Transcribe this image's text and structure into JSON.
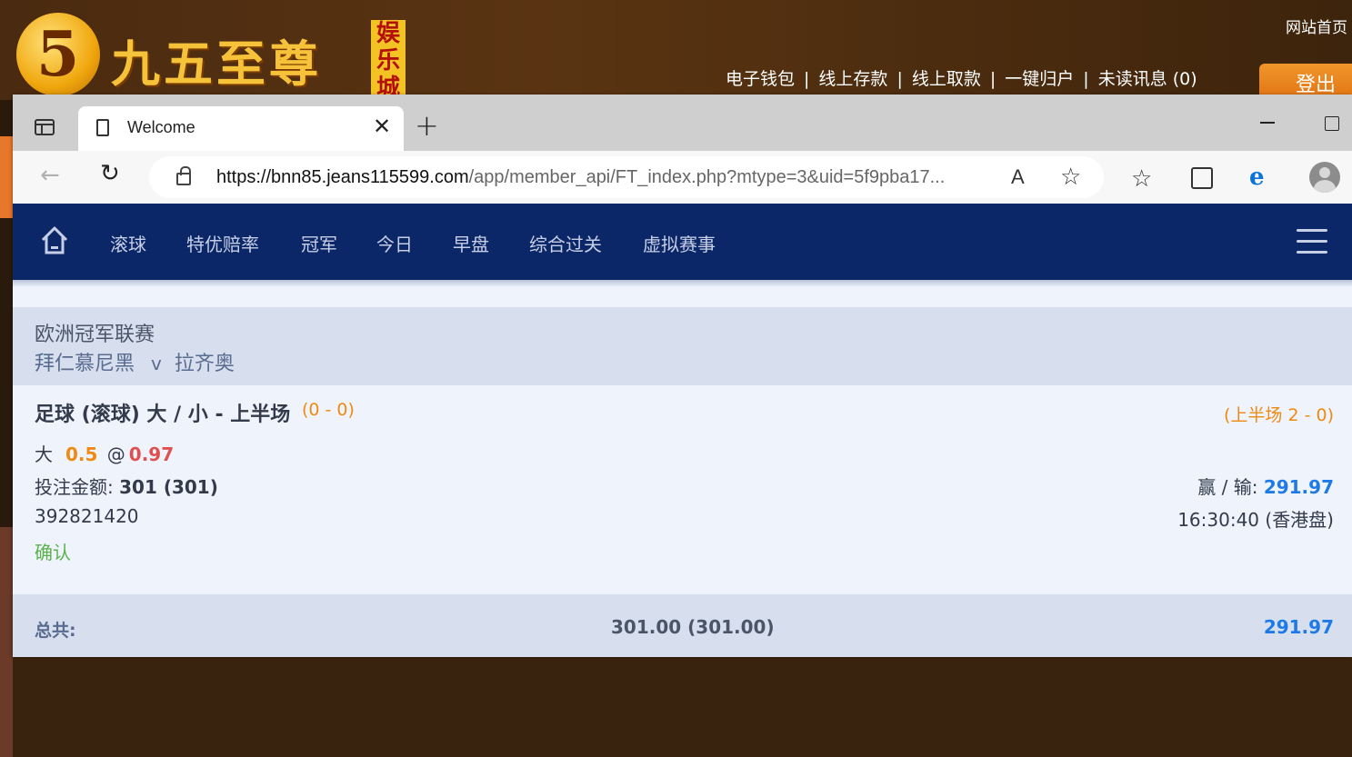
{
  "site": {
    "logo_digit": "5",
    "logo_text": "九五至尊",
    "logo_badge": "娱乐城",
    "home_link": "网站首页",
    "nav_links": [
      "电子钱包",
      "线上存款",
      "线上取款",
      "一键归户",
      "未读讯息 (0)"
    ],
    "nav_sep": "|",
    "login": "登出"
  },
  "browser": {
    "tab_title": "Welcome",
    "url_host": "https://bnn85.jeans115599.com",
    "url_path": "/app/member_api/FT_index.php?mtype=3&uid=5f9pba17...",
    "read_aloud_glyph": "A"
  },
  "nav": {
    "items": [
      "滚球",
      "特优赔率",
      "冠军",
      "今日",
      "早盘",
      "综合过关",
      "虚拟赛事"
    ]
  },
  "league": {
    "name": "欧洲冠军联赛",
    "home_team": "拜仁慕尼黑",
    "vs": "v",
    "away_team": "拉齐奥"
  },
  "bet": {
    "title": "足球 (滚球) 大 / 小 - 上半场",
    "score": "(0 - 0)",
    "half_score": "(上半场 2 - 0)",
    "selection": "大",
    "handicap": "0.5",
    "at": "@",
    "odds": "0.97",
    "stake_label": "投注金额:",
    "stake_value": "301 (301)",
    "winloss_label": "赢 / 输:",
    "winloss_value": "291.97",
    "ticket_id": "392821420",
    "time": "16:30:40 (香港盘)",
    "status": "确认"
  },
  "total": {
    "label": "总共:",
    "stake": "301.00 (301.00)",
    "win": "291.97"
  }
}
